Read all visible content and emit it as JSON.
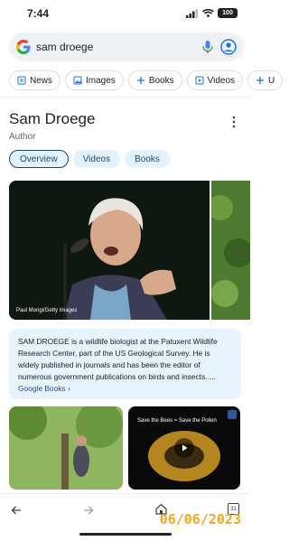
{
  "status_bar": {
    "time": "7:44",
    "battery": "100"
  },
  "search": {
    "query": "sam droege"
  },
  "chips": [
    {
      "label": "News",
      "icon": "news-icon"
    },
    {
      "label": "Images",
      "icon": "image-icon"
    },
    {
      "label": "Books",
      "icon": "plus-icon"
    },
    {
      "label": "Videos",
      "icon": "video-icon"
    },
    {
      "label": "U",
      "icon": "plus-icon"
    }
  ],
  "knowledge_panel": {
    "title": "Sam Droege",
    "subtitle": "Author",
    "tabs": [
      "Overview",
      "Videos",
      "Books"
    ],
    "image_credit": "Paul Morigi/Getty Images",
    "description": "SAM DROEGE is a wildlife biologist at the Patuxent Wildlife Research Center, part of the US Geological Survey. He is widely published in journals and has been the editor of numerous government publications on birds and insects. ...",
    "description_link": "Google Books ›"
  },
  "videos": [
    {
      "overlay_title": ""
    },
    {
      "overlay_title": "Save the Bees = Save the Pollen"
    }
  ],
  "bottom_nav": {
    "tab_count": "31"
  },
  "date_stamp": "06/06/2023",
  "colors": {
    "accent": "#1a73e8",
    "chip_border": "#dadce0",
    "tab_bg": "#e3f2fd",
    "desc_bg": "#e8f4fd",
    "stamp": "#f5a623"
  }
}
